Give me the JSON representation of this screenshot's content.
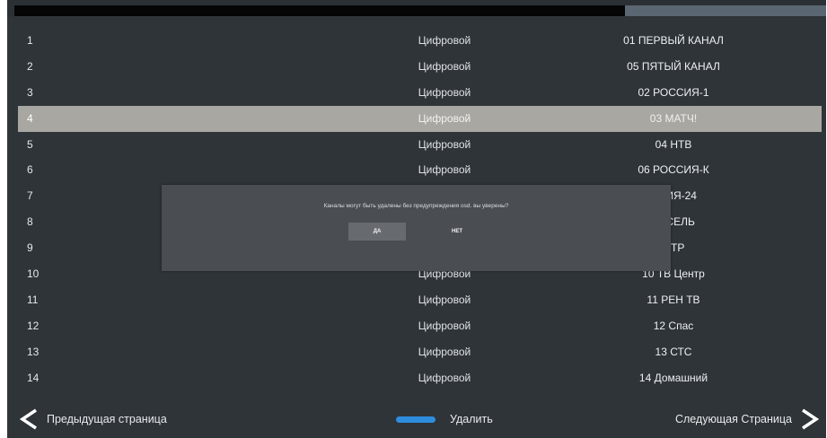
{
  "channels": [
    {
      "num": "1",
      "type": "Цифровой",
      "name": "01 ПЕРВЫЙ КАНАЛ"
    },
    {
      "num": "2",
      "type": "Цифровой",
      "name": "05 ПЯТЫЙ КАНАЛ"
    },
    {
      "num": "3",
      "type": "Цифровой",
      "name": "02 РОССИЯ-1"
    },
    {
      "num": "4",
      "type": "Цифровой",
      "name": "03 МАТЧ!"
    },
    {
      "num": "5",
      "type": "Цифровой",
      "name": "04 НТВ"
    },
    {
      "num": "6",
      "type": "Цифровой",
      "name": "06 РОССИЯ-К"
    },
    {
      "num": "7",
      "type": "",
      "name": "ССИЯ-24"
    },
    {
      "num": "8",
      "type": "",
      "name": "РУСЕЛЬ"
    },
    {
      "num": "9",
      "type": "",
      "name": "ОТР"
    },
    {
      "num": "10",
      "type": "Цифровой",
      "name": "10 ТВ Центр"
    },
    {
      "num": "11",
      "type": "Цифровой",
      "name": "11 РЕН ТВ"
    },
    {
      "num": "12",
      "type": "Цифровой",
      "name": "12 Спас"
    },
    {
      "num": "13",
      "type": "Цифровой",
      "name": "13 СТС"
    },
    {
      "num": "14",
      "type": "Цифровой",
      "name": "14 Домашний"
    }
  ],
  "selected_index": 3,
  "dialog": {
    "message": "Каналы могут быть удалены без предупреждения osd. вы уверены?",
    "yes_label": "ДА",
    "no_label": "НЕТ"
  },
  "footer": {
    "prev_label": "Предыдущая страница",
    "delete_label": "Удалить",
    "next_label": "Следующая Страница",
    "delete_key_color": "#2e8dde"
  },
  "icons": {
    "prev": "chevron-left-icon",
    "next": "chevron-right-icon",
    "delete_key": "blue-key-icon"
  }
}
